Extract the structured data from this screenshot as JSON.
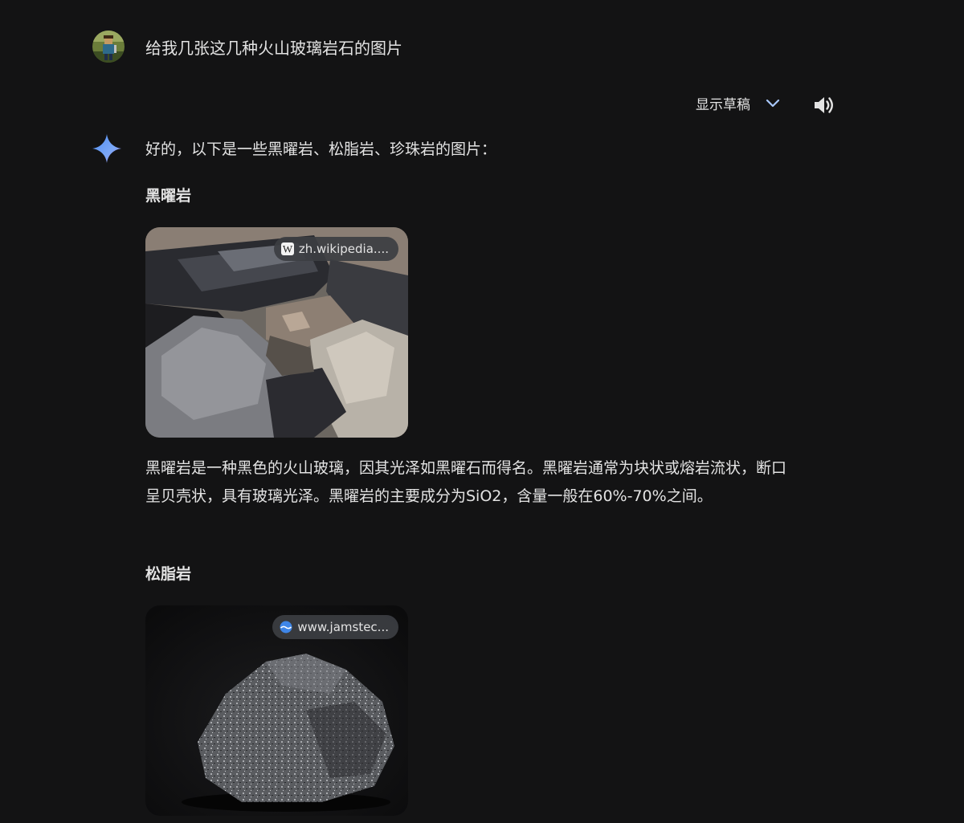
{
  "user_message": {
    "text": "给我几张这几种火山玻璃岩石的图片"
  },
  "toolbar": {
    "drafts_label": "显示草稿"
  },
  "response": {
    "intro": "好的，以下是一些黑曜岩、松脂岩、珍珠岩的图片：",
    "sections": [
      {
        "heading": "黑曜岩",
        "image_source": "zh.wikipedia....",
        "description": "黑曜岩是一种黑色的火山玻璃，因其光泽如黑曜石而得名。黑曜岩通常为块状或熔岩流状，断口呈贝壳状，具有玻璃光泽。黑曜岩的主要成分为SiO2，含量一般在60%-70%之间。"
      },
      {
        "heading": "松脂岩",
        "image_source": "www.jamstec..."
      }
    ]
  },
  "colors": {
    "background": "#131314",
    "text": "#e3e3e3",
    "chip_bg": "#3c3e42",
    "chevron": "#a8c7fa"
  },
  "icons": {
    "avatar": "user-avatar",
    "chevron": "chevron-down-icon",
    "speaker": "speaker-icon",
    "spark": "gemini-spark-icon",
    "wikipedia": "wikipedia-icon",
    "globe": "globe-icon"
  }
}
